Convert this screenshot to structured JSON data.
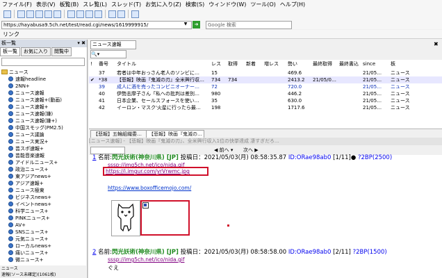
{
  "menu": [
    "ファイル(F)",
    "表示(V)",
    "板覧(B)",
    "スレ覧(L)",
    "スレッド(T)",
    "お気に入り(Z)",
    "検索(S)",
    "ウィンドウ(W)",
    "ツール(O)",
    "ヘルプ(H)"
  ],
  "address": {
    "url": "https://hayabusa9.5ch.net/test/read.cgi/news/1619999915/",
    "search_placeholder": "Google 検索"
  },
  "link_label": "リンク",
  "left": {
    "title": "板一覧",
    "tabs": [
      "板一覧",
      "お気に入り",
      "閲覧中"
    ],
    "tree": [
      "ニュース",
      "速報headline",
      "2NN+",
      "ニュース速報",
      "ニュース速報+(動画)",
      "ニュース速報+",
      "ニュース速報(嫌)",
      "ニュース速報(嫌+)",
      "中国スモッグ(PM2.5)",
      "ニュース議論",
      "ニュース実況+",
      "芸スポ速報+",
      "芸能音楽速報",
      "アイドルニュース+",
      "政治ニュース+",
      "東アジアnews+",
      "アジア速報+",
      "ニュース極東",
      "ビジネスnews+",
      "イベントnews+",
      "科学ニュース+",
      "PINKニュース+",
      "AV+",
      "SNSニュース+",
      "元気ニュース+",
      "ローカルnews+",
      "痛いニュース+",
      "微ニュース+"
    ],
    "status_lines": [
      "ニュース",
      "速報(ソース未確定)(1061枚)"
    ]
  },
  "threadlist": {
    "tab": "ニュース速報",
    "headers": [
      "!",
      "番号",
      "タイトル",
      "レス",
      "取得",
      "新着",
      "増レス",
      "勢い",
      "最終取得",
      "最終書込",
      "since",
      "板"
    ],
    "rows": [
      {
        "mark": "",
        "num": "37",
        "title": "若者は中年おっさん老人のソンビに…",
        "res": "15",
        "get": "",
        "new": "",
        "inc": "",
        "speed": "469.6",
        "lastget": "",
        "lastwrite": "",
        "since": "21/05…",
        "board": "ニュース",
        "style": ""
      },
      {
        "mark": "✔",
        "num": "*38",
        "title": "【悲報】映画『鬼滅の刃』全米興行収…",
        "res": "734",
        "get": "734",
        "new": "",
        "inc": "",
        "speed": "2413.2",
        "lastget": "21/05/0…",
        "lastwrite": "",
        "since": "21/05…",
        "board": "ニュース",
        "style": ""
      },
      {
        "mark": "",
        "num": "39",
        "title": "成人に酒を売ったコンビニオーナー…",
        "res": "72",
        "get": "",
        "new": "",
        "inc": "",
        "speed": "720.0",
        "lastget": "",
        "lastwrite": "",
        "since": "21/05…",
        "board": "ニュース",
        "style": "blue"
      },
      {
        "mark": "",
        "num": "40",
        "title": "伊勢志摩子さん「私への批判は差別…",
        "res": "980",
        "get": "",
        "new": "",
        "inc": "",
        "speed": "446.2",
        "lastget": "",
        "lastwrite": "",
        "since": "21/05…",
        "board": "ニュース",
        "style": ""
      },
      {
        "mark": "",
        "num": "41",
        "title": "日本企業、セールスフォースを使い…",
        "res": "35",
        "get": "",
        "new": "",
        "inc": "",
        "speed": "630.0",
        "lastget": "",
        "lastwrite": "",
        "since": "21/05…",
        "board": "ニュース",
        "style": ""
      },
      {
        "mark": "",
        "num": "42",
        "title": "イーロン・マスク'火星に行ったら最…",
        "res": "198",
        "get": "",
        "new": "",
        "inc": "",
        "speed": "1717.6",
        "lastget": "",
        "lastwrite": "",
        "since": "21/05…",
        "board": "ニュース",
        "style": ""
      }
    ]
  },
  "midtabs": [
    "【悲報】五輪組織委…",
    "【悲報】映画『鬼滅の…"
  ],
  "thread": {
    "title": "[ニュース速報] - 【悲報】映画『鬼滅の刃』、全米興行収入1位の快挙達成 凄すぎだろ…",
    "nav_prev": "前へ",
    "nav_next": "次へ",
    "posts": [
      {
        "num": "1",
        "label": "名前:",
        "name": "閃光妖術(神奈川県) [JP]",
        "mail": "",
        "date": "投稿日：2021/05/03(月) 08:58:35.87",
        "id": "ID:ORae98ab0",
        "count": "[1/11]",
        "extra": "?2BP(2500)",
        "links": [
          "sssp://img5ch.net/ico/nida.gif",
          "https://i.imgur.com/yrVrwmc.jpg",
          "https://www.boxofficemojo.com/"
        ]
      },
      {
        "num": "2",
        "label": "名前:",
        "name": "閃光妖術(神奈川県) [JP]",
        "mail": "",
        "date": "投稿日：2021/05/03(月) 08:58:58.00",
        "id": "ID:ORae98ab0",
        "count": "[2/11]",
        "extra": "?2BP(1500)",
        "links": [
          "sssp://img5ch.net/ico/nida.gif"
        ],
        "body": "ぐえ"
      }
    ]
  }
}
